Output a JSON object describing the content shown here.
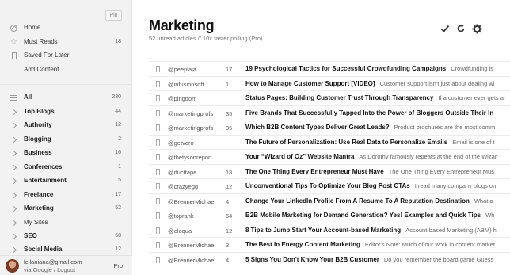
{
  "sidebar": {
    "pin_label": "Pin",
    "top_items": [
      {
        "label": "Home",
        "icon": "home-icon",
        "count": ""
      },
      {
        "label": "Must Reads",
        "icon": "star-icon",
        "count": "18"
      },
      {
        "label": "Saved For Later",
        "icon": "bookmark-icon",
        "count": ""
      },
      {
        "label": "Add Content",
        "icon": "",
        "count": ""
      }
    ],
    "categories": [
      {
        "label": "All",
        "icon": "list-icon",
        "count": "230",
        "bold": true
      },
      {
        "label": "Top Blogs",
        "icon": "chevron-right-icon",
        "count": "44",
        "bold": true
      },
      {
        "label": "Authority",
        "icon": "chevron-right-icon",
        "count": "12",
        "bold": true
      },
      {
        "label": "Blogging",
        "icon": "chevron-right-icon",
        "count": "2",
        "bold": true
      },
      {
        "label": "Business",
        "icon": "chevron-right-icon",
        "count": "16",
        "bold": true
      },
      {
        "label": "Conferences",
        "icon": "chevron-right-icon",
        "count": "1",
        "bold": true
      },
      {
        "label": "Entertainment",
        "icon": "chevron-right-icon",
        "count": "5",
        "bold": true
      },
      {
        "label": "Freelance",
        "icon": "chevron-right-icon",
        "count": "17",
        "bold": true
      },
      {
        "label": "Marketing",
        "icon": "chevron-right-icon",
        "count": "52",
        "bold": true
      },
      {
        "label": "My Sites",
        "icon": "chevron-right-icon",
        "count": "",
        "bold": false
      },
      {
        "label": "SEO",
        "icon": "chevron-right-icon",
        "count": "68",
        "bold": true
      },
      {
        "label": "Social Media",
        "icon": "chevron-right-icon",
        "count": "12",
        "bold": true
      }
    ],
    "user": {
      "email": "leilaniana@gmail.com",
      "via": "via Google / Logout",
      "plan": "Pro"
    }
  },
  "main": {
    "title": "Marketing",
    "subtitle": "52 unread articles  //  10x faster polling (Pro)",
    "toolbar": {
      "mark_read_icon": "checkmark-icon",
      "refresh_icon": "refresh-icon",
      "settings_icon": "gear-icon"
    },
    "articles": [
      {
        "source": "@peeplaja",
        "count": "17",
        "headline": "19 Psychological Tactics for Successful Crowdfunding Campaigns",
        "snippet": "Crowdfunding is"
      },
      {
        "source": "@infusionsoft",
        "count": "1",
        "headline": "How to Manage Customer Support [VIDEO]",
        "snippet": "Customer support isn't just about dealing wi"
      },
      {
        "source": "@pingdom",
        "count": "",
        "headline": "Status Pages: Building Customer Trust Through Transparency",
        "snippet": "If a customer ever gets ar"
      },
      {
        "source": "@marketingprofs",
        "count": "35",
        "headline": "Five Brands That Successfully Tapped Into the Power of Bloggers Outside Their In",
        "snippet": ""
      },
      {
        "source": "@marketingprofs",
        "count": "35",
        "headline": "Which B2B Content Types Deliver Great Leads?",
        "snippet": "Product brochures are the most comm"
      },
      {
        "source": "@getvero",
        "count": "",
        "headline": "The Future of Personalization: Use Real Data to Personalize Emails",
        "snippet": "Email is one of t"
      },
      {
        "source": "@thetysonreport",
        "count": "",
        "headline": "Your “Wizard of Oz” Website Mantra",
        "snippet": "As Dorothy famously repeats at the end of the Wizar"
      },
      {
        "source": "@ducttape",
        "count": "18",
        "headline": "The One Thing Every Entrepreneur Must Have",
        "snippet": "The One Thing Every Entrepreneur Mus"
      },
      {
        "source": "@crazyegg",
        "count": "12",
        "headline": "Unconventional Tips To Optimize Your Blog Post CTAs",
        "snippet": "I read many company blogs on"
      },
      {
        "source": "@BrennerMichael",
        "count": "4",
        "headline": "Change Your LinkedIn Profile From A Resume To A Reputation Destination",
        "snippet": "What o"
      },
      {
        "source": "@toprank",
        "count": "64",
        "headline": "B2B Mobile Marketing for Demand Generation? Yes! Examples and Quick Tips",
        "snippet": "Wh"
      },
      {
        "source": "@eloqua",
        "count": "12",
        "headline": "8 Tips to Jump Start Your Account-based Marketing",
        "snippet": "Account-based Marketing (ABM) h"
      },
      {
        "source": "@BrennerMichael",
        "count": "3",
        "headline": "The Best In Energy Content Marketing",
        "snippet": "Editor's Note: Much of our work in content market"
      },
      {
        "source": "@BrennerMichael",
        "count": "4",
        "headline": "5 Signs You Don't Know Your B2B Customer",
        "snippet": "Do you remember the board game Guess"
      }
    ]
  }
}
